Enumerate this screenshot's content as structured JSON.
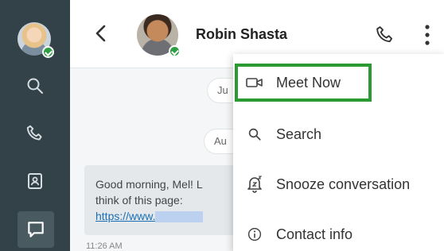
{
  "header": {
    "contact_name": "Robin Shasta"
  },
  "chat": {
    "date_pill_1": "Ju",
    "date_pill_2": "Au",
    "message": {
      "line1": "Good morning, Mel! L",
      "line2": "think of this page:",
      "link": "https://www."
    },
    "timestamp": "11:26 AM"
  },
  "menu": {
    "items": [
      {
        "label": "Meet Now",
        "icon": "video-camera-icon"
      },
      {
        "label": "Search",
        "icon": "search-icon"
      },
      {
        "label": "Snooze conversation",
        "icon": "snooze-bell-icon"
      },
      {
        "label": "Contact info",
        "icon": "info-icon"
      }
    ]
  },
  "colors": {
    "rail_bg": "#334148",
    "highlight_border": "#2b9a33",
    "presence": "#2e9e44",
    "link": "#1a6fb5"
  }
}
